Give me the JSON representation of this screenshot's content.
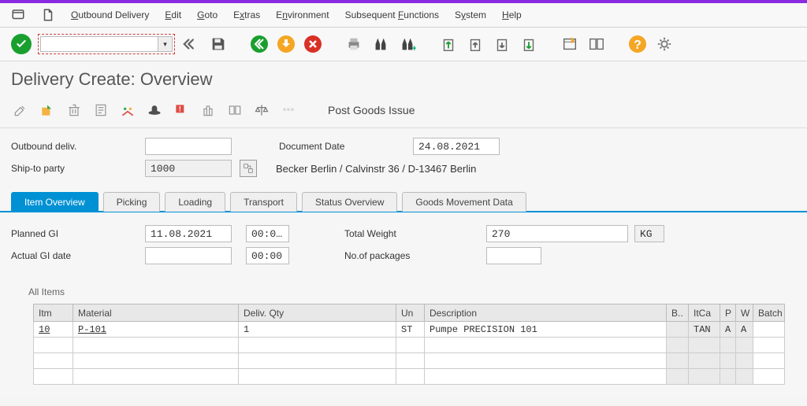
{
  "menubar": {
    "items": [
      "Outbound Delivery",
      "Edit",
      "Goto",
      "Extras",
      "Environment",
      "Subsequent Functions",
      "System",
      "Help"
    ]
  },
  "toolbar": {
    "command_value": ""
  },
  "page_title": "Delivery  Create: Overview",
  "app_toolbar": {
    "post_goods_issue": "Post Goods Issue"
  },
  "header": {
    "outbound_label": "Outbound deliv.",
    "outbound_value": "",
    "doc_date_label": "Document Date",
    "doc_date_value": "24.08.2021",
    "ship_to_label": "Ship-to party",
    "ship_to_value": "1000",
    "ship_to_text": "Becker Berlin / Calvinstr 36 / D-13467 Berlin"
  },
  "tabs": {
    "items": [
      "Item Overview",
      "Picking",
      "Loading",
      "Transport",
      "Status Overview",
      "Goods Movement Data"
    ],
    "active": 0
  },
  "overview": {
    "planned_gi_label": "Planned GI",
    "planned_gi_date": "11.08.2021",
    "planned_gi_time": "00:0…",
    "actual_gi_label": "Actual GI date",
    "actual_gi_date": "",
    "actual_gi_time": "00:00",
    "total_weight_label": "Total Weight",
    "total_weight_value": "270",
    "total_weight_unit": "KG",
    "packages_label": "No.of packages",
    "packages_value": ""
  },
  "grid": {
    "title": "All Items",
    "columns": [
      "Itm",
      "Material",
      "Deliv. Qty",
      "Un",
      "Description",
      "B..",
      "ItCa",
      "P",
      "W",
      "Batch"
    ],
    "rows": [
      {
        "itm": "10",
        "material": "P-101",
        "qty": "1",
        "un": "ST",
        "desc": "Pumpe PRECISION 101",
        "b": "",
        "itca": "TAN",
        "p": "A",
        "w": "A",
        "batch": ""
      },
      {
        "itm": "",
        "material": "",
        "qty": "",
        "un": "",
        "desc": "",
        "b": "",
        "itca": "",
        "p": "",
        "w": "",
        "batch": ""
      },
      {
        "itm": "",
        "material": "",
        "qty": "",
        "un": "",
        "desc": "",
        "b": "",
        "itca": "",
        "p": "",
        "w": "",
        "batch": ""
      },
      {
        "itm": "",
        "material": "",
        "qty": "",
        "un": "",
        "desc": "",
        "b": "",
        "itca": "",
        "p": "",
        "w": "",
        "batch": ""
      }
    ]
  }
}
